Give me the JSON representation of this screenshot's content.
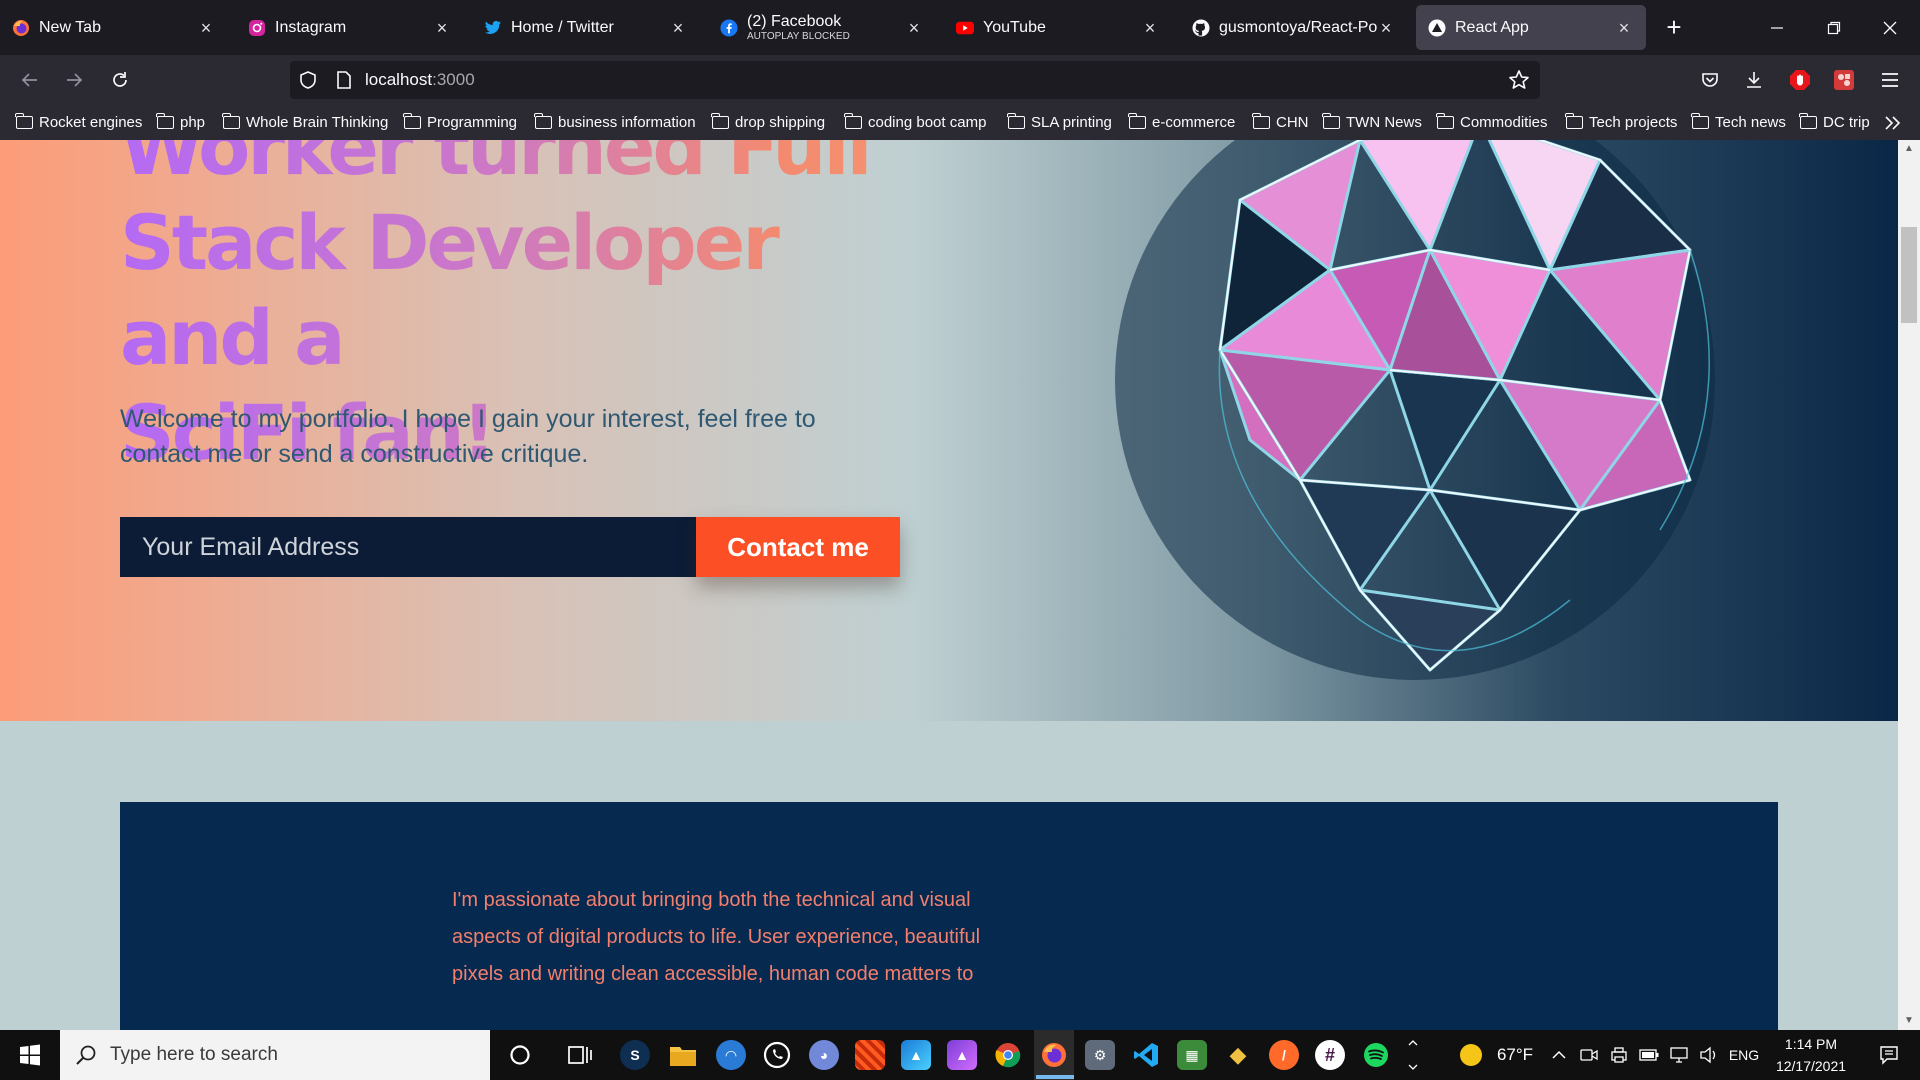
{
  "tabs": [
    {
      "title": "New Tab",
      "favicon": "firefox-icon"
    },
    {
      "title": "Instagram",
      "favicon": "instagram-icon"
    },
    {
      "title": "Home / Twitter",
      "favicon": "twitter-icon"
    },
    {
      "title": "(2) Facebook",
      "subtitle": "AUTOPLAY BLOCKED",
      "favicon": "facebook-icon"
    },
    {
      "title": "YouTube",
      "favicon": "youtube-icon"
    },
    {
      "title": "gusmontoya/React-Portf",
      "favicon": "github-icon"
    },
    {
      "title": "React App",
      "favicon": "react-app-icon",
      "active": true
    }
  ],
  "nav": {
    "url_host": "localhost",
    "url_port": ":3000"
  },
  "bookmarks": [
    "Rocket engines",
    "php",
    "Whole Brain Thinking",
    "Programming",
    "business information",
    "drop shipping",
    "coding boot camp",
    "SLA printing",
    "e-commerce",
    "CHN",
    "TWN News",
    "Commodities",
    "Tech projects",
    "Tech news",
    "DC trip"
  ],
  "hero": {
    "title_line1": "Worker turned Full",
    "title_line2": "Stack Developer and a",
    "title_line3": "SciFi fan!",
    "subtitle": "Welcome to my portfolio. I hope I gain your interest, feel free to contact me or send a constructive critique.",
    "email_placeholder": "Your Email Address",
    "contact_button": "Contact me"
  },
  "about": {
    "text": "I'm passionate about bringing both the technical and visual aspects of digital products to life. User experience, beautiful pixels and writing clean accessible, human code matters to"
  },
  "taskbar": {
    "search_placeholder": "Type here to search",
    "weather": "67°F",
    "language": "ENG",
    "time": "1:14 PM",
    "date": "12/17/2021"
  },
  "colors": {
    "accent_orange": "#fd4f25",
    "navy": "#05294f",
    "about_text": "#f47f6d",
    "title_purple": "#b46af4"
  }
}
